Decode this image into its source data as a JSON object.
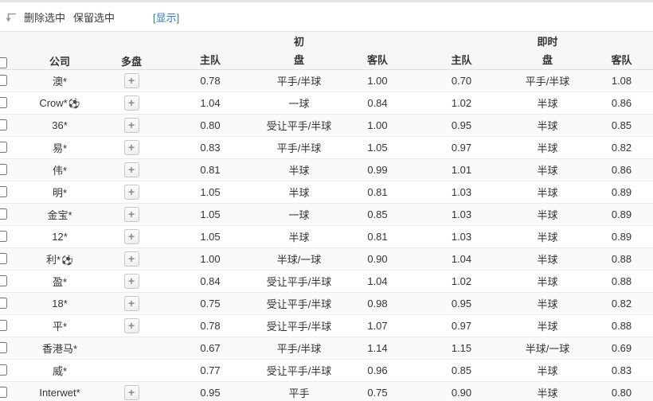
{
  "colors": {
    "accent_link": "#2577c9",
    "header_bg": "#f6f6f6",
    "row_alt_bg": "#fafafa",
    "border": "#ededed",
    "text": "#333333"
  },
  "toolbar": {
    "corner_arrow_icon": "corner-left-down-arrow-icon",
    "delete_selected_label": "删除选中",
    "keep_selected_label": "保留选中",
    "show_link_label": "[显示]"
  },
  "table": {
    "plus_label": "+",
    "ball_icon": "⚽",
    "headers": {
      "company": "公司",
      "multi": "多盘",
      "initial_group_line1": "初",
      "initial_group_line2": "盘",
      "live_group_line1": "即时",
      "live_group_line2": "盘",
      "home": "主队",
      "away": "客队"
    },
    "rows": [
      {
        "company": "澳*",
        "has_ball": false,
        "has_plus": true,
        "init_home": "0.78",
        "init_handicap": "平手/半球",
        "init_away": "1.00",
        "live_home": "0.70",
        "live_handicap": "平手/半球",
        "live_away": "1.08"
      },
      {
        "company": "Crow*",
        "has_ball": true,
        "has_plus": true,
        "init_home": "1.04",
        "init_handicap": "一球",
        "init_away": "0.84",
        "live_home": "1.02",
        "live_handicap": "半球",
        "live_away": "0.86"
      },
      {
        "company": "36*",
        "has_ball": false,
        "has_plus": true,
        "init_home": "0.80",
        "init_handicap": "受让平手/半球",
        "init_away": "1.00",
        "live_home": "0.95",
        "live_handicap": "半球",
        "live_away": "0.85"
      },
      {
        "company": "易*",
        "has_ball": false,
        "has_plus": true,
        "init_home": "0.83",
        "init_handicap": "平手/半球",
        "init_away": "1.05",
        "live_home": "0.97",
        "live_handicap": "半球",
        "live_away": "0.82"
      },
      {
        "company": "伟*",
        "has_ball": false,
        "has_plus": true,
        "init_home": "0.81",
        "init_handicap": "半球",
        "init_away": "0.99",
        "live_home": "1.01",
        "live_handicap": "半球",
        "live_away": "0.86"
      },
      {
        "company": "明*",
        "has_ball": false,
        "has_plus": true,
        "init_home": "1.05",
        "init_handicap": "半球",
        "init_away": "0.81",
        "live_home": "1.03",
        "live_handicap": "半球",
        "live_away": "0.89"
      },
      {
        "company": "金宝*",
        "has_ball": false,
        "has_plus": true,
        "init_home": "1.05",
        "init_handicap": "一球",
        "init_away": "0.85",
        "live_home": "1.03",
        "live_handicap": "半球",
        "live_away": "0.89"
      },
      {
        "company": "12*",
        "has_ball": false,
        "has_plus": true,
        "init_home": "1.05",
        "init_handicap": "半球",
        "init_away": "0.81",
        "live_home": "1.03",
        "live_handicap": "半球",
        "live_away": "0.89"
      },
      {
        "company": "利*",
        "has_ball": true,
        "has_plus": true,
        "init_home": "1.00",
        "init_handicap": "半球/一球",
        "init_away": "0.90",
        "live_home": "1.04",
        "live_handicap": "半球",
        "live_away": "0.88"
      },
      {
        "company": "盈*",
        "has_ball": false,
        "has_plus": true,
        "init_home": "0.84",
        "init_handicap": "受让平手/半球",
        "init_away": "1.04",
        "live_home": "1.02",
        "live_handicap": "半球",
        "live_away": "0.88"
      },
      {
        "company": "18*",
        "has_ball": false,
        "has_plus": true,
        "init_home": "0.75",
        "init_handicap": "受让平手/半球",
        "init_away": "0.98",
        "live_home": "0.95",
        "live_handicap": "半球",
        "live_away": "0.82"
      },
      {
        "company": "平*",
        "has_ball": false,
        "has_plus": true,
        "init_home": "0.78",
        "init_handicap": "受让平手/半球",
        "init_away": "1.07",
        "live_home": "0.97",
        "live_handicap": "半球",
        "live_away": "0.88"
      },
      {
        "company": "香港马*",
        "has_ball": false,
        "has_plus": false,
        "init_home": "0.67",
        "init_handicap": "平手/半球",
        "init_away": "1.14",
        "live_home": "1.15",
        "live_handicap": "半球/一球",
        "live_away": "0.69"
      },
      {
        "company": "威*",
        "has_ball": false,
        "has_plus": false,
        "init_home": "0.77",
        "init_handicap": "受让平手/半球",
        "init_away": "0.96",
        "live_home": "0.85",
        "live_handicap": "半球",
        "live_away": "0.83"
      },
      {
        "company": "Interwet*",
        "has_ball": false,
        "has_plus": true,
        "init_home": "0.95",
        "init_handicap": "平手",
        "init_away": "0.75",
        "live_home": "0.90",
        "live_handicap": "半球",
        "live_away": "0.80"
      }
    ]
  }
}
